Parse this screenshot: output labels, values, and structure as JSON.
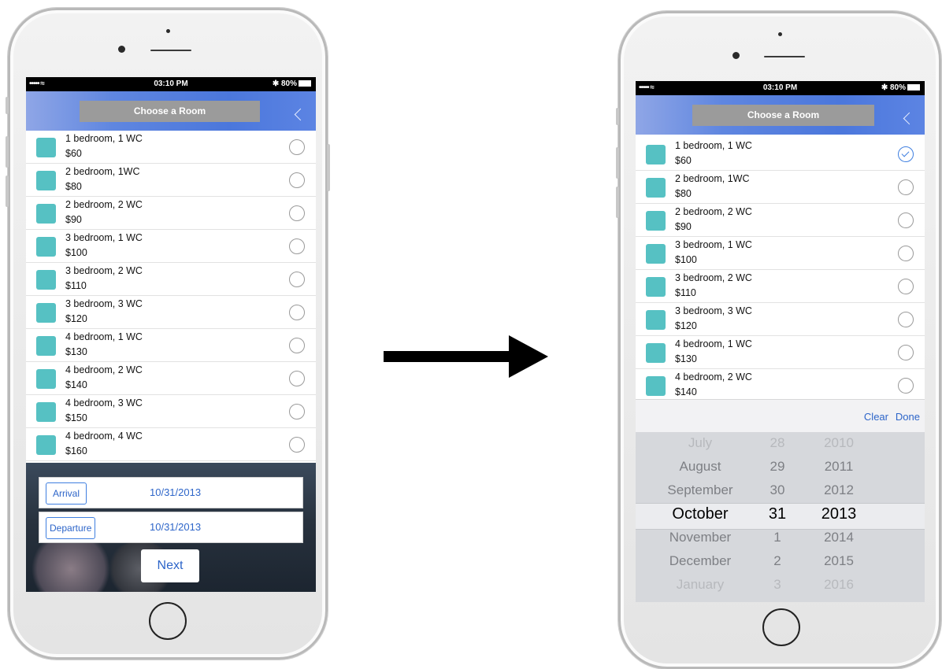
{
  "status": {
    "carrier": "••••• ≈",
    "time": "03:10 PM",
    "battery": "✱ 80%"
  },
  "nav": {
    "title": "Choose a Room"
  },
  "rooms": [
    {
      "name": "1 bedroom, 1 WC",
      "price": "$60"
    },
    {
      "name": "2 bedroom, 1WC",
      "price": "$80"
    },
    {
      "name": "2 bedroom, 2 WC",
      "price": "$90"
    },
    {
      "name": "3 bedroom, 1 WC",
      "price": "$100"
    },
    {
      "name": "3 bedroom, 2 WC",
      "price": "$110"
    },
    {
      "name": "3 bedroom, 3 WC",
      "price": "$120"
    },
    {
      "name": "4 bedroom, 1 WC",
      "price": "$130"
    },
    {
      "name": "4 bedroom, 2 WC",
      "price": "$140"
    },
    {
      "name": "4 bedroom, 3 WC",
      "price": "$150"
    },
    {
      "name": "4 bedroom, 4 WC",
      "price": "$160"
    }
  ],
  "selected_room_index": 0,
  "form": {
    "arrival_label": "Arrival",
    "arrival_value": "10/31/2013",
    "departure_label": "Departure",
    "departure_value": "10/31/2013",
    "next_label": "Next"
  },
  "picker": {
    "clear_label": "Clear",
    "done_label": "Done",
    "months": [
      "July",
      "August",
      "September",
      "October",
      "November",
      "December",
      "January"
    ],
    "days": [
      "28",
      "29",
      "30",
      "31",
      "1",
      "2",
      "3"
    ],
    "years": [
      "2010",
      "2011",
      "2012",
      "2013",
      "2014",
      "2015",
      "2016"
    ],
    "selected_index": 3
  },
  "colors": {
    "accent": "#2d65c9",
    "room_swatch": "#56c1c3",
    "nav_blue": "#4b77dc",
    "title_gray": "#9b9b9b"
  }
}
